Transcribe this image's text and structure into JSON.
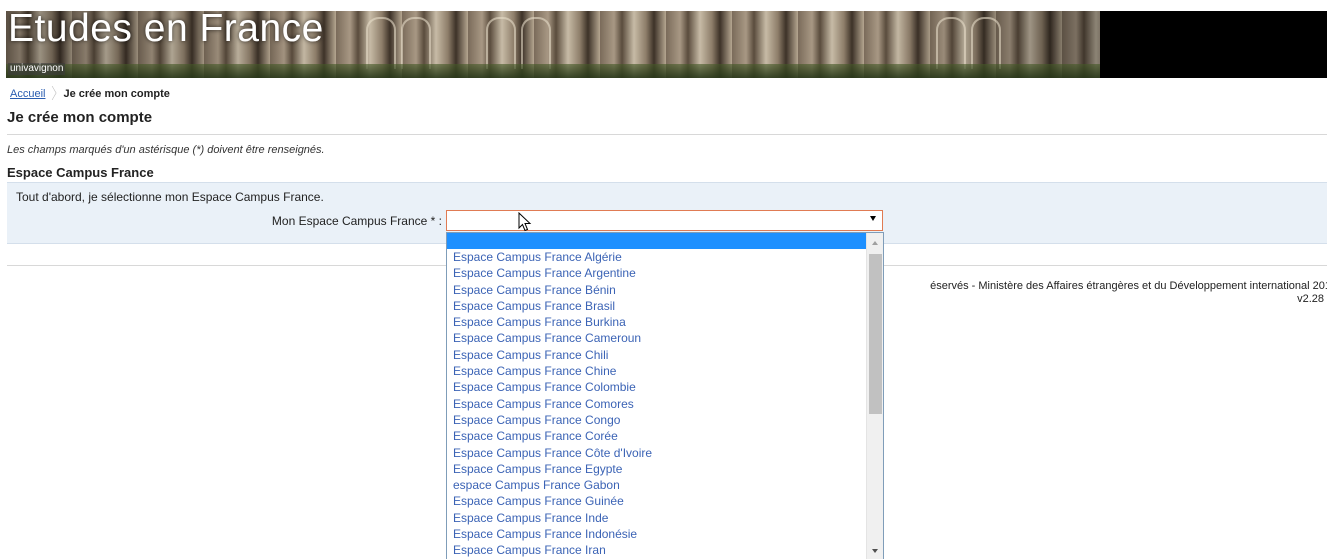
{
  "header": {
    "site_title": "Etudes en France",
    "site_subtitle": "univavignon"
  },
  "breadcrumb": {
    "home_label": "Accueil",
    "current_label": "Je crée mon compte"
  },
  "page": {
    "title": "Je crée mon compte",
    "required_note": "Les champs marqués d'un astérisque (*) doivent être renseignés."
  },
  "section": {
    "title": "Espace Campus France",
    "intro": "Tout d'abord, je sélectionne mon Espace Campus France.",
    "field_label": "Mon Espace Campus France * :",
    "selected_value": ""
  },
  "dropdown": {
    "options": [
      "",
      "Espace Campus France Algérie",
      "Espace Campus France Argentine",
      "Espace Campus France Bénin",
      "Espace Campus France Brasil",
      "Espace Campus France Burkina",
      "Espace Campus France Cameroun",
      "Espace Campus France Chili",
      "Espace Campus France Chine",
      "Espace Campus France Colombie",
      "Espace Campus France Comores",
      "Espace Campus France Congo",
      "Espace Campus France Corée",
      "Espace Campus France Côte d'Ivoire",
      "Espace Campus France Egypte",
      "espace Campus France Gabon",
      "Espace Campus France Guinée",
      "Espace Campus France Inde",
      "Espace Campus France Indonésie",
      "Espace Campus France Iran"
    ],
    "selected_index": 0
  },
  "footer": {
    "copyright_fragment": "éservés - Ministère des Affaires étrangères et du Développement international 201",
    "version": "v2.28"
  },
  "colors": {
    "link": "#2a5db0",
    "option_text": "#3b63b5",
    "selection": "#1e90ff",
    "section_bg": "#eaf1f8",
    "select_border": "#e07b53"
  }
}
